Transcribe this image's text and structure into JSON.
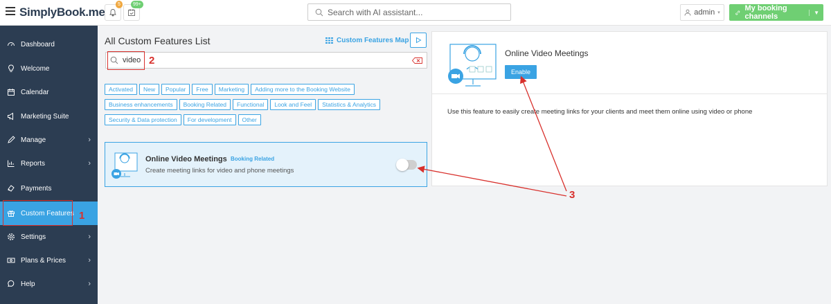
{
  "header": {
    "logo_text": "SimplyBook.me",
    "notifications_badge": "5",
    "calendar_badge": "99+",
    "search_placeholder": "Search with AI assistant...",
    "admin_label": "admin",
    "channels_label": "My booking channels"
  },
  "sidebar": {
    "items": [
      {
        "label": "Dashboard",
        "icon": "dashboard-icon"
      },
      {
        "label": "Welcome",
        "icon": "lightbulb-icon"
      },
      {
        "label": "Calendar",
        "icon": "calendar-icon"
      },
      {
        "label": "Marketing Suite",
        "icon": "megaphone-icon"
      },
      {
        "label": "Manage",
        "icon": "pencil-icon"
      },
      {
        "label": "Reports",
        "icon": "chart-icon"
      },
      {
        "label": "Payments",
        "icon": "payments-icon"
      },
      {
        "label": "Custom Features",
        "icon": "gift-icon"
      },
      {
        "label": "Settings",
        "icon": "gear-icon"
      },
      {
        "label": "Plans & Prices",
        "icon": "money-icon"
      },
      {
        "label": "Help",
        "icon": "help-icon"
      }
    ]
  },
  "main": {
    "title": "All Custom Features List",
    "map_link": "Custom Features Map",
    "search_value": "video",
    "tags": [
      "Activated",
      "New",
      "Popular",
      "Free",
      "Marketing",
      "Adding more to the Booking Website",
      "Business enhancements",
      "Booking Related",
      "Functional",
      "Look and Feel",
      "Statistics & Analytics",
      "Security & Data protection",
      "For development",
      "Other"
    ],
    "card": {
      "name": "Online Video Meetings",
      "badge": "Booking Related",
      "description": "Create meeting links for video and phone meetings"
    }
  },
  "detail": {
    "title": "Online Video Meetings",
    "enable_label": "Enable",
    "description": "Use this feature to easily create meeting links for your clients and meet them online using video or phone"
  },
  "annotations": {
    "one": "1",
    "two": "2",
    "three": "3"
  },
  "colors": {
    "accent": "#3aa3e3",
    "sidebar": "#2c3d52",
    "success": "#6fcf73",
    "annotation": "#d8302c"
  }
}
